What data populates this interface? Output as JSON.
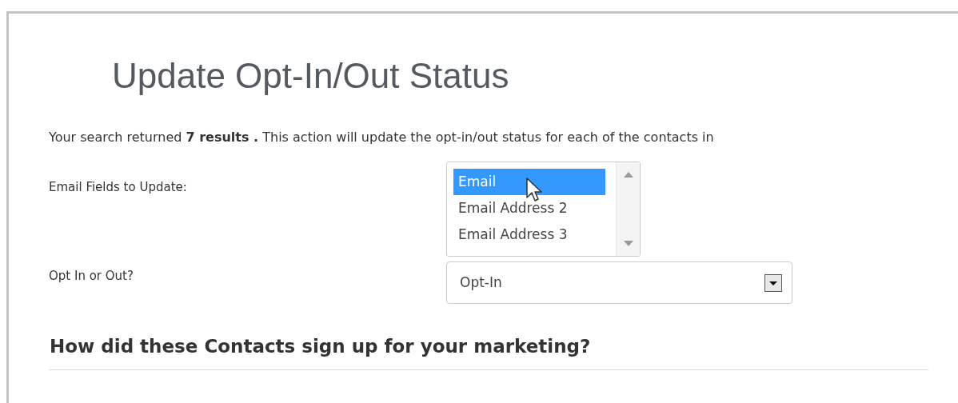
{
  "title": "Update Opt-In/Out Status",
  "summary": "Your search returned **7 results .** This action will update the opt-in/out status for each of the contacts in",
  "email_fields": {
    "label": "Email Fields to Update:",
    "options": [
      {
        "label": "Email",
        "selected": true
      },
      {
        "label": "Email Address 2",
        "selected": false
      },
      {
        "label": "Email Address 3",
        "selected": false
      }
    ]
  },
  "opt_in_or_out": {
    "label": "Opt In or Out?",
    "value": "Opt-In"
  },
  "section_heading": "How did these Contacts sign up for your marketing?"
}
